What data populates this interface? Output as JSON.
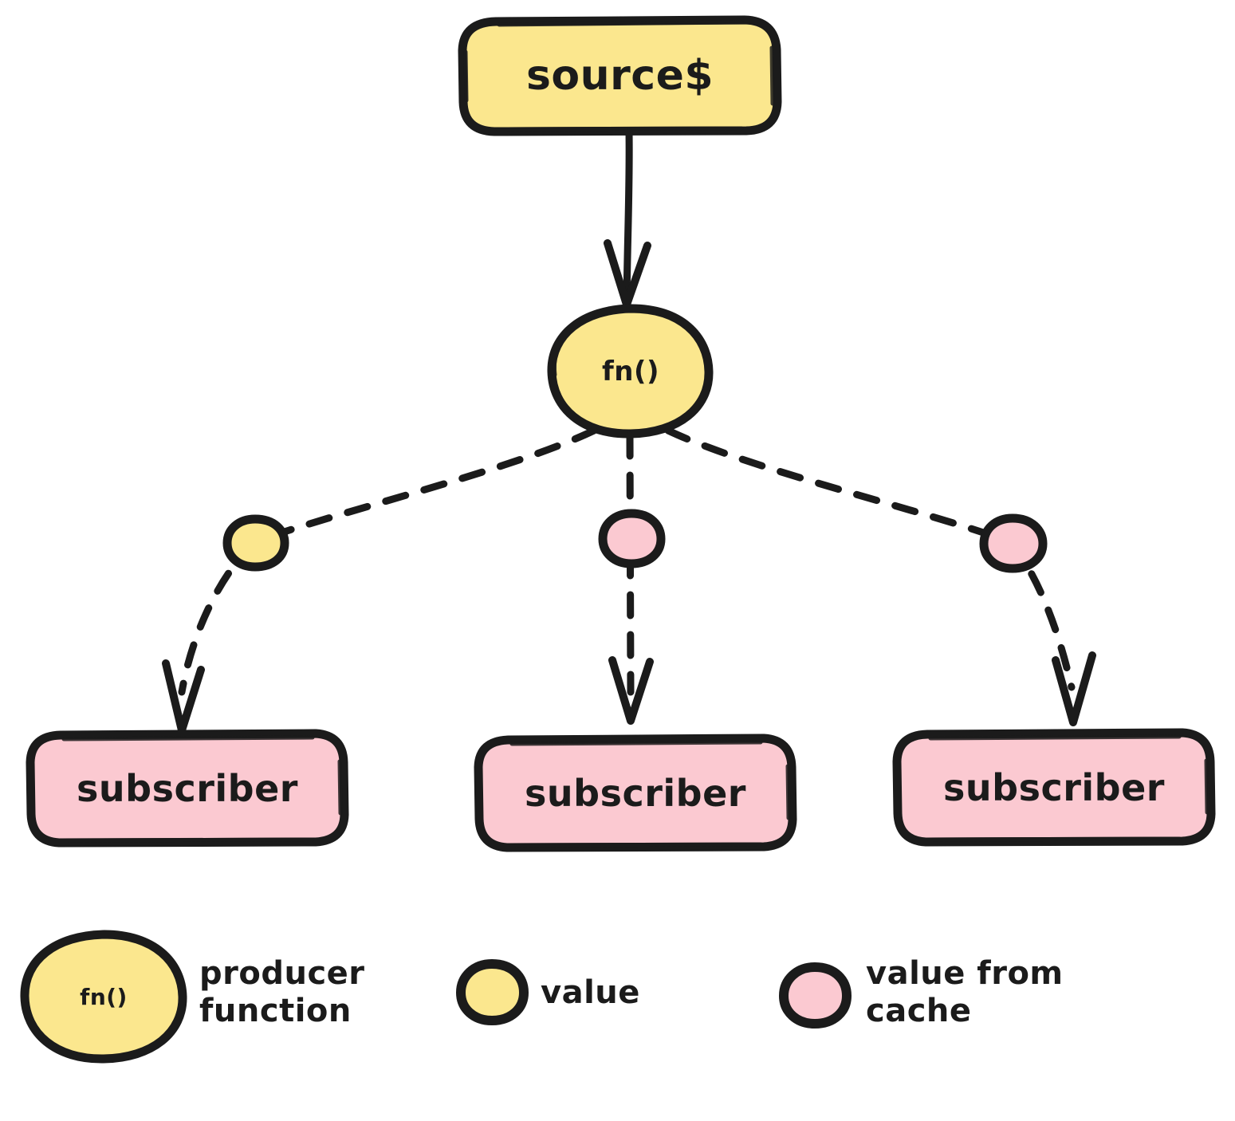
{
  "diagram": {
    "title": "source$ producer function with cached values to subscribers",
    "colors": {
      "yellow_fill": "#fbe78e",
      "pink_fill": "#fbc9d1",
      "stroke": "#1b1b1b",
      "background": "#ffffff"
    },
    "nodes": {
      "source": {
        "label": "source$",
        "shape": "rounded-rect",
        "fill": "#fbe78e"
      },
      "producer": {
        "label": "fn()",
        "shape": "ellipse",
        "fill": "#fbe78e"
      },
      "subscribers": [
        {
          "label": "subscriber",
          "shape": "rounded-rect",
          "fill": "#fbc9d1"
        },
        {
          "label": "subscriber",
          "shape": "rounded-rect",
          "fill": "#fbc9d1"
        },
        {
          "label": "subscriber",
          "shape": "rounded-rect",
          "fill": "#fbc9d1"
        }
      ]
    },
    "value_dots": [
      {
        "kind": "value",
        "fill": "#fbe78e"
      },
      {
        "kind": "value-from-cache",
        "fill": "#fbc9d1"
      },
      {
        "kind": "value-from-cache",
        "fill": "#fbc9d1"
      }
    ],
    "edges": [
      {
        "from": "source",
        "to": "producer",
        "style": "solid",
        "arrow": true
      },
      {
        "from": "producer",
        "to": "subscriber-1",
        "style": "dashed",
        "arrow": true
      },
      {
        "from": "producer",
        "to": "subscriber-2",
        "style": "dashed",
        "arrow": true
      },
      {
        "from": "producer",
        "to": "subscriber-3",
        "style": "dashed",
        "arrow": true
      }
    ]
  },
  "legend": {
    "items": [
      {
        "marker": "ellipse-fn",
        "marker_label": "fn()",
        "text": "producer\nfunction",
        "fill": "#fbe78e"
      },
      {
        "marker": "circle",
        "marker_label": "",
        "text": "value",
        "fill": "#fbe78e"
      },
      {
        "marker": "circle",
        "marker_label": "",
        "text": "value from\ncache",
        "fill": "#fbc9d1"
      }
    ]
  }
}
